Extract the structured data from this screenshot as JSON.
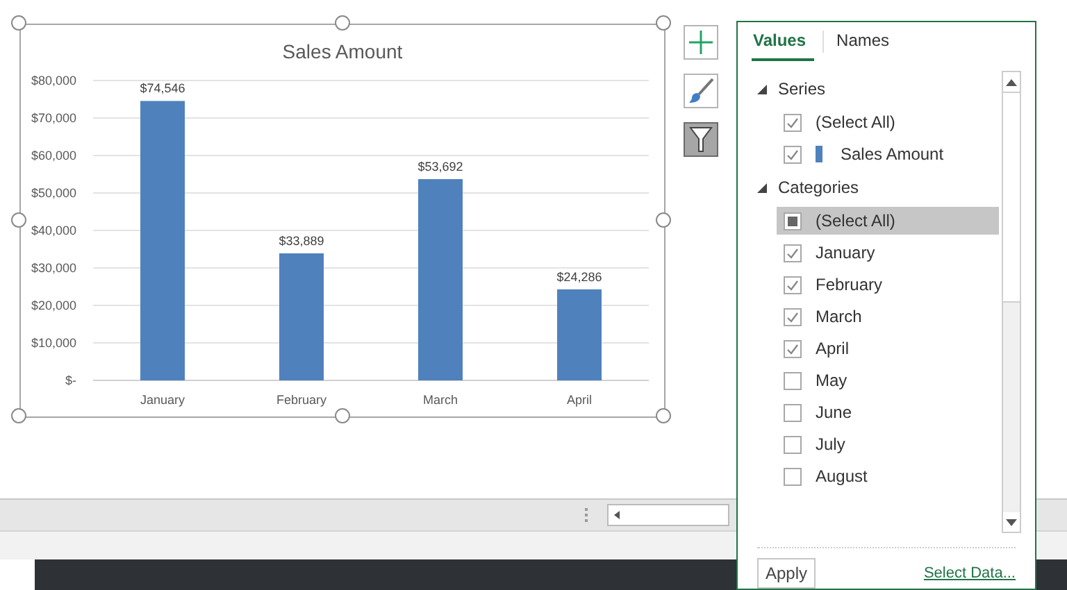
{
  "chart": {
    "chart_data": {
      "type": "bar",
      "title": "Sales Amount",
      "categories": [
        "January",
        "February",
        "March",
        "April"
      ],
      "grid": true,
      "series": [
        {
          "color": "#4f81bd",
          "values": [
            74546,
            33889,
            53692,
            24286
          ]
        }
      ],
      "ylim": [
        0,
        80000
      ],
      "yticks": [
        {
          "value": 0,
          "label": "$-"
        },
        {
          "value": 10000,
          "label": "$10,000"
        },
        {
          "value": 20000,
          "label": "$20,000"
        },
        {
          "value": 30000,
          "label": "$30,000"
        },
        {
          "value": 40000,
          "label": "$40,000"
        },
        {
          "value": 50000,
          "label": "$50,000"
        },
        {
          "value": 60000,
          "label": "$60,000"
        },
        {
          "value": 70000,
          "label": "$70,000"
        },
        {
          "value": 80000,
          "label": "$80,000"
        }
      ],
      "value_labels": [
        "$74,546",
        "$33,889",
        "$53,692",
        "$24,286"
      ]
    }
  },
  "side_buttons": [
    {
      "kind": "add",
      "selected": false
    },
    {
      "kind": "style",
      "selected": false
    },
    {
      "kind": "filter",
      "selected": true
    }
  ],
  "filter_panel": {
    "tabs": [
      {
        "label": "Values",
        "selected": true
      },
      {
        "label": "Names",
        "selected": false
      }
    ],
    "sections": [
      {
        "label": "Series",
        "expanded": true,
        "items": [
          {
            "label": "(Select All)",
            "checked": true,
            "partial": false,
            "selected": false
          },
          {
            "label": "Sales Amount",
            "checked": true,
            "partial": false,
            "selected": false,
            "color": "#4f81bd"
          }
        ]
      },
      {
        "label": "Categories",
        "expanded": true,
        "items": [
          {
            "label": "(Select All)",
            "checked": false,
            "partial": true,
            "selected": true
          },
          {
            "label": "January",
            "checked": true,
            "partial": false,
            "selected": false
          },
          {
            "label": "February",
            "checked": true,
            "partial": false,
            "selected": false
          },
          {
            "label": "March",
            "checked": true,
            "partial": false,
            "selected": false
          },
          {
            "label": "April",
            "checked": true,
            "partial": false,
            "selected": false
          },
          {
            "label": "May",
            "checked": false,
            "partial": false,
            "selected": false
          },
          {
            "label": "June",
            "checked": false,
            "partial": false,
            "selected": false
          },
          {
            "label": "July",
            "checked": false,
            "partial": false,
            "selected": false
          },
          {
            "label": "August",
            "checked": false,
            "partial": false,
            "selected": false
          }
        ]
      }
    ],
    "apply": "Apply",
    "link": "Select Data..."
  }
}
